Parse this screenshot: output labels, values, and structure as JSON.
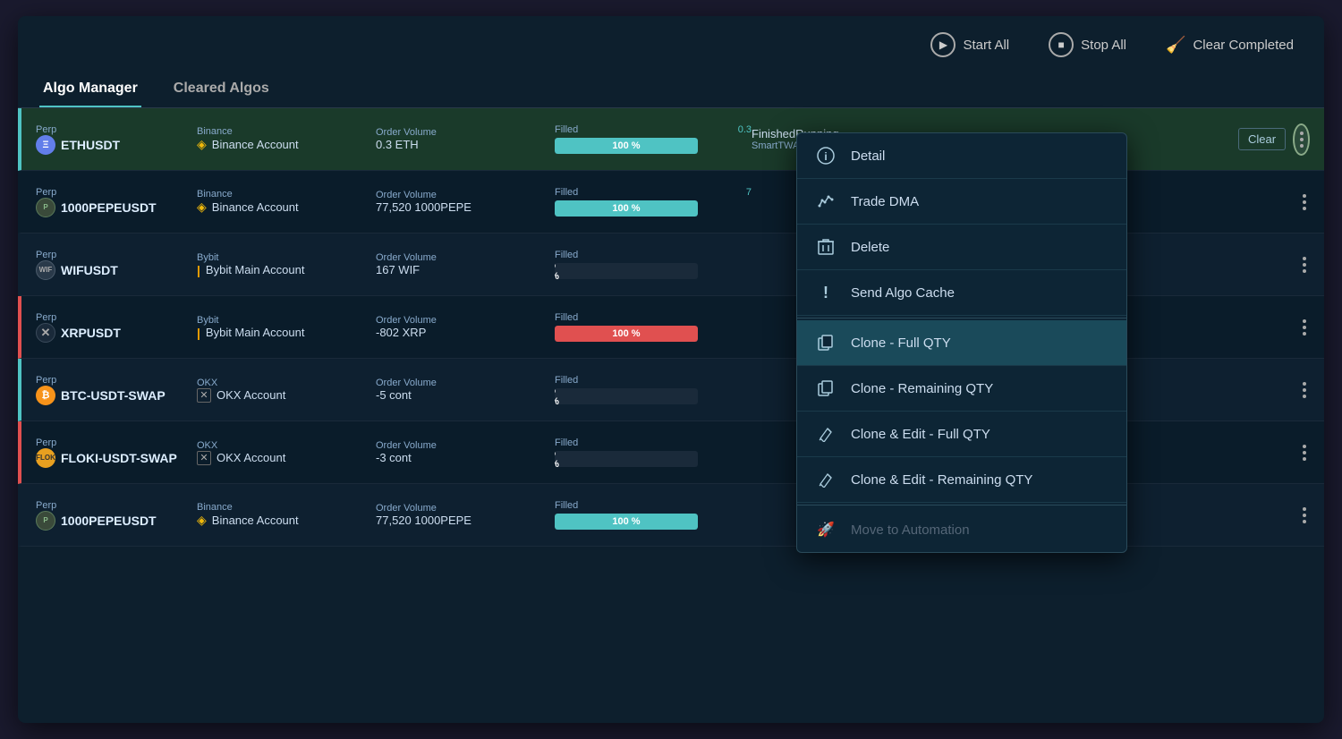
{
  "toolbar": {
    "start_all": "Start All",
    "stop_all": "Stop All",
    "clear_completed": "Clear Completed"
  },
  "tabs": [
    {
      "id": "algo-manager",
      "label": "Algo Manager",
      "active": true
    },
    {
      "id": "cleared-algos",
      "label": "Cleared Algos",
      "active": false
    }
  ],
  "rows": [
    {
      "id": 1,
      "highlighted": true,
      "left_border": "teal",
      "instrument_type": "Perp",
      "instrument": "ETHUSDT",
      "coin": "ETH",
      "exchange_label": "Binance",
      "exchange_account": "Binance Account",
      "exchange_type": "binance",
      "vol_label": "Order Volume",
      "vol_value": "0.3 ETH",
      "filled_label": "Filled",
      "filled_amount": "0.3",
      "filled_pct": 100,
      "fill_color": "teal",
      "status": "FinishedRunning",
      "algo": "SmartTWAP",
      "show_clear": true,
      "show_dots_circle": true
    },
    {
      "id": 2,
      "highlighted": false,
      "left_border": "none",
      "instrument_type": "Perp",
      "instrument": "1000PEPEUSDT",
      "coin": "PEPE",
      "exchange_label": "Binance",
      "exchange_account": "Binance Account",
      "exchange_type": "binance",
      "vol_label": "Order Volume",
      "vol_value": "77,520 1000PEPE",
      "filled_label": "Filled",
      "filled_amount": "7",
      "filled_pct": 100,
      "fill_color": "teal",
      "status": "",
      "algo": "",
      "show_clear": false,
      "show_dots_circle": false
    },
    {
      "id": 3,
      "highlighted": false,
      "left_border": "none",
      "instrument_type": "Perp",
      "instrument": "WIFUSDT",
      "coin": "WIF",
      "exchange_label": "Bybit",
      "exchange_account": "Bybit Main Account",
      "exchange_type": "bybit",
      "vol_label": "Order Volume",
      "vol_value": "167 WIF",
      "filled_label": "Filled",
      "filled_amount": "",
      "filled_pct": 0,
      "fill_color": "gray",
      "status": "",
      "algo": "",
      "show_clear": false,
      "show_dots_circle": false
    },
    {
      "id": 4,
      "highlighted": false,
      "left_border": "red",
      "instrument_type": "Perp",
      "instrument": "XRPUSDT",
      "coin": "XRP",
      "exchange_label": "Bybit",
      "exchange_account": "Bybit Main Account",
      "exchange_type": "bybit",
      "vol_label": "Order Volume",
      "vol_value": "-802 XRP",
      "filled_label": "Filled",
      "filled_amount": "",
      "filled_pct": 100,
      "fill_color": "red",
      "status": "",
      "algo": "",
      "show_clear": false,
      "show_dots_circle": false
    },
    {
      "id": 5,
      "highlighted": false,
      "left_border": "teal",
      "instrument_type": "Perp",
      "instrument": "BTC-USDT-SWAP",
      "coin": "BTC",
      "exchange_label": "OKX",
      "exchange_account": "OKX Account",
      "exchange_type": "okx",
      "vol_label": "Order Volume",
      "vol_value": "-5 cont",
      "filled_label": "Filled",
      "filled_amount": "",
      "filled_pct": 0,
      "fill_color": "gray",
      "status": "",
      "algo": "",
      "show_clear": false,
      "show_dots_circle": false
    },
    {
      "id": 6,
      "highlighted": false,
      "left_border": "red",
      "instrument_type": "Perp",
      "instrument": "FLOKI-USDT-SWAP",
      "coin": "FLOKI",
      "exchange_label": "OKX",
      "exchange_account": "OKX Account",
      "exchange_type": "okx",
      "vol_label": "Order Volume",
      "vol_value": "-3 cont",
      "filled_label": "Filled",
      "filled_amount": "",
      "filled_pct": 0,
      "fill_color": "gray",
      "status": "",
      "algo": "",
      "show_clear": false,
      "show_dots_circle": false
    },
    {
      "id": 7,
      "highlighted": false,
      "left_border": "none",
      "instrument_type": "Perp",
      "instrument": "1000PEPEUSDT",
      "coin": "PEPE",
      "exchange_label": "Binance",
      "exchange_account": "Binance Account",
      "exchange_type": "binance",
      "vol_label": "Order Volume",
      "vol_value": "77,520 1000PEPE",
      "filled_label": "Filled",
      "filled_amount": "",
      "filled_pct": 100,
      "fill_color": "teal",
      "status": "",
      "algo": "",
      "show_clear": false,
      "show_dots_circle": false
    }
  ],
  "context_menu": {
    "items": [
      {
        "id": "detail",
        "label": "Detail",
        "icon": "info",
        "disabled": false,
        "active": false,
        "divider_after": false
      },
      {
        "id": "trade-dma",
        "label": "Trade DMA",
        "icon": "chart",
        "disabled": false,
        "active": false,
        "divider_after": false
      },
      {
        "id": "delete",
        "label": "Delete",
        "icon": "trash",
        "disabled": false,
        "active": false,
        "divider_after": false
      },
      {
        "id": "send-algo-cache",
        "label": "Send Algo Cache",
        "icon": "exclaim",
        "disabled": false,
        "active": false,
        "divider_after": true
      },
      {
        "id": "clone-full-qty",
        "label": "Clone - Full QTY",
        "icon": "clone",
        "disabled": false,
        "active": true,
        "divider_after": false
      },
      {
        "id": "clone-remaining-qty",
        "label": "Clone - Remaining QTY",
        "icon": "clone2",
        "disabled": false,
        "active": false,
        "divider_after": false
      },
      {
        "id": "clone-edit-full-qty",
        "label": "Clone & Edit - Full QTY",
        "icon": "pen",
        "disabled": false,
        "active": false,
        "divider_after": false
      },
      {
        "id": "clone-edit-remaining-qty",
        "label": "Clone & Edit - Remaining QTY",
        "icon": "pen2",
        "disabled": false,
        "active": false,
        "divider_after": true
      },
      {
        "id": "move-to-automation",
        "label": "Move to Automation",
        "icon": "rocket",
        "disabled": true,
        "active": false,
        "divider_after": false
      }
    ]
  },
  "clear_btn_label": "Clear"
}
